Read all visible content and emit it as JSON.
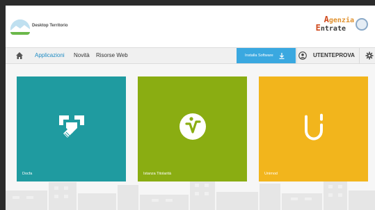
{
  "header": {
    "app_title": "Desktop Territorio",
    "brand_line1": "genzia",
    "brand_line2": "ntrate",
    "brand_cap1": "A",
    "brand_cap2": "E"
  },
  "nav": {
    "items": [
      {
        "label": "Applicazioni",
        "active": true
      },
      {
        "label": "Novità",
        "active": false
      },
      {
        "label": "Risorse Web",
        "active": false
      }
    ],
    "install_label": "Installa Software",
    "username": "UTENTEPROVA"
  },
  "tiles": [
    {
      "label": "Docfa",
      "color": "#1f9ba0",
      "icon": "docfa-icon"
    },
    {
      "label": "Istanza Titolarità",
      "color": "#8aad12",
      "icon": "voltura-icon"
    },
    {
      "label": "Unimod",
      "color": "#f2b51c",
      "icon": "unimod-icon"
    }
  ],
  "colors": {
    "accent": "#3aa8e0",
    "active_link": "#1e8bc3"
  }
}
